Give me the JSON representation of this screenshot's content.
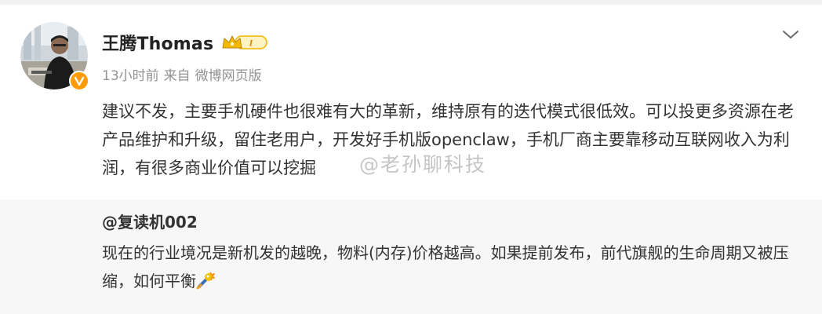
{
  "post": {
    "author": "王腾Thomas",
    "vip_level": "I",
    "time": "13小时前",
    "source_prefix": "来自",
    "source": "微博网页版",
    "text": "建议不发，主要手机硬件也很难有大的革新，维持原有的迭代模式很低效。可以投更多资源在老产品维护和升级，留住老用户，开发好手机版openclaw，手机厂商主要靠移动互联网收入为利润，有很多商业价值可以挖掘"
  },
  "repost": {
    "author": "@复读机002",
    "text": "现在的行业境况是新机发的越晚，物料(内存)价格越高。如果提前发布，前代旗舰的生命周期又被压缩，如何平衡",
    "emoji": "bomb-emoji"
  },
  "watermark": "@老孙聊科技",
  "colors": {
    "badge_orange": "#ff9b00",
    "vip_gold": "#f5b800",
    "meta_gray": "#939393",
    "repost_bg": "#f7f7f7"
  },
  "icons": {
    "chevron": "chevron-down-icon",
    "verified": "verified-badge-icon",
    "vip": "crown-vip-icon"
  }
}
